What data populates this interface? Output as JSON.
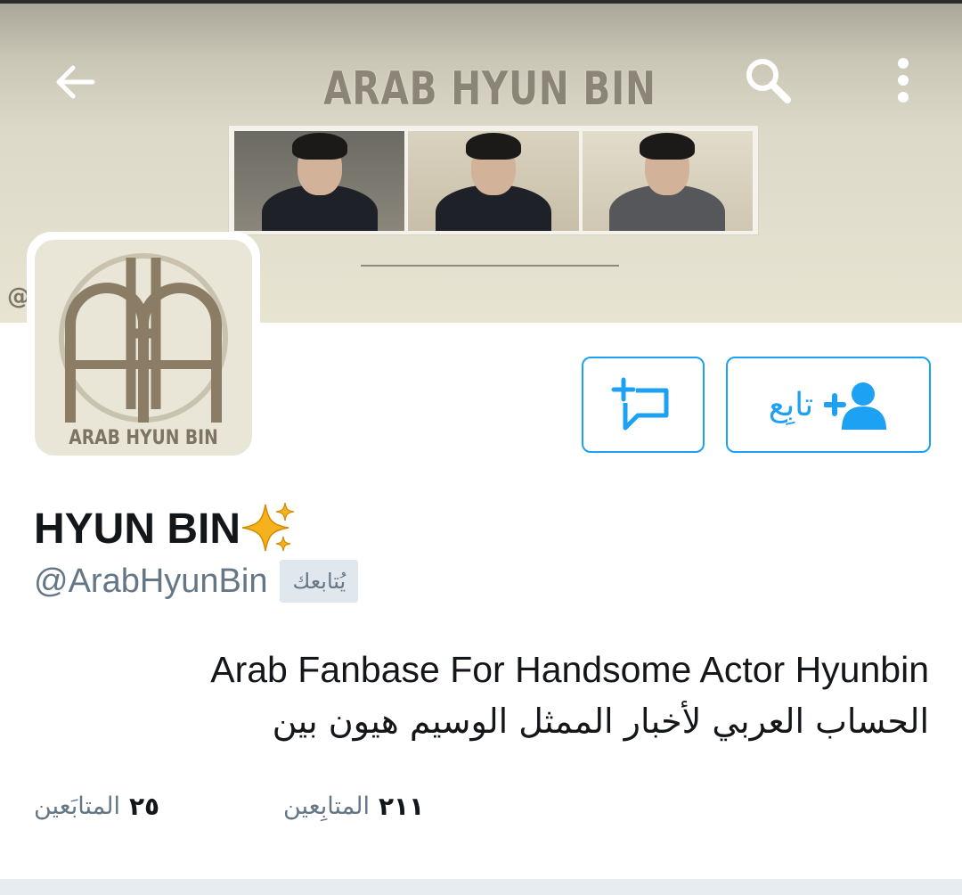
{
  "header": {
    "back_icon": "arrow-left-icon",
    "search_icon": "search-icon",
    "more_icon": "more-vertical-icon",
    "banner_title": "ARAB HYUN BIN",
    "banner_handle_fragment": "@",
    "colors": {
      "banner_bg": "#e8e4d2",
      "banner_text": "#8a8577"
    }
  },
  "avatar": {
    "monogram": "AHB",
    "caption": "ARAB HYUN BIN",
    "colors": {
      "bg": "#e9e6d7",
      "logo": "#8b7d65"
    }
  },
  "actions": {
    "dm_icon": "add-message-icon",
    "follow_icon": "add-user-icon",
    "follow_label": "تابِع",
    "accent": "#1da1f2"
  },
  "profile": {
    "display_name": "HYUN BIN",
    "name_emoji": "sparkles-icon",
    "handle": "@ArabHyunBin",
    "follows_you": "يُتابعك",
    "bio_en": "Arab Fanbase For Handsome Actor Hyunbin",
    "bio_ar": "الحساب العربي لأخبار الممثل الوسيم هيون بين"
  },
  "stats": {
    "following": {
      "count": "٢١١",
      "label": "المتابِعين"
    },
    "followers": {
      "count": "٢٥",
      "label": "المتابَعين"
    }
  }
}
